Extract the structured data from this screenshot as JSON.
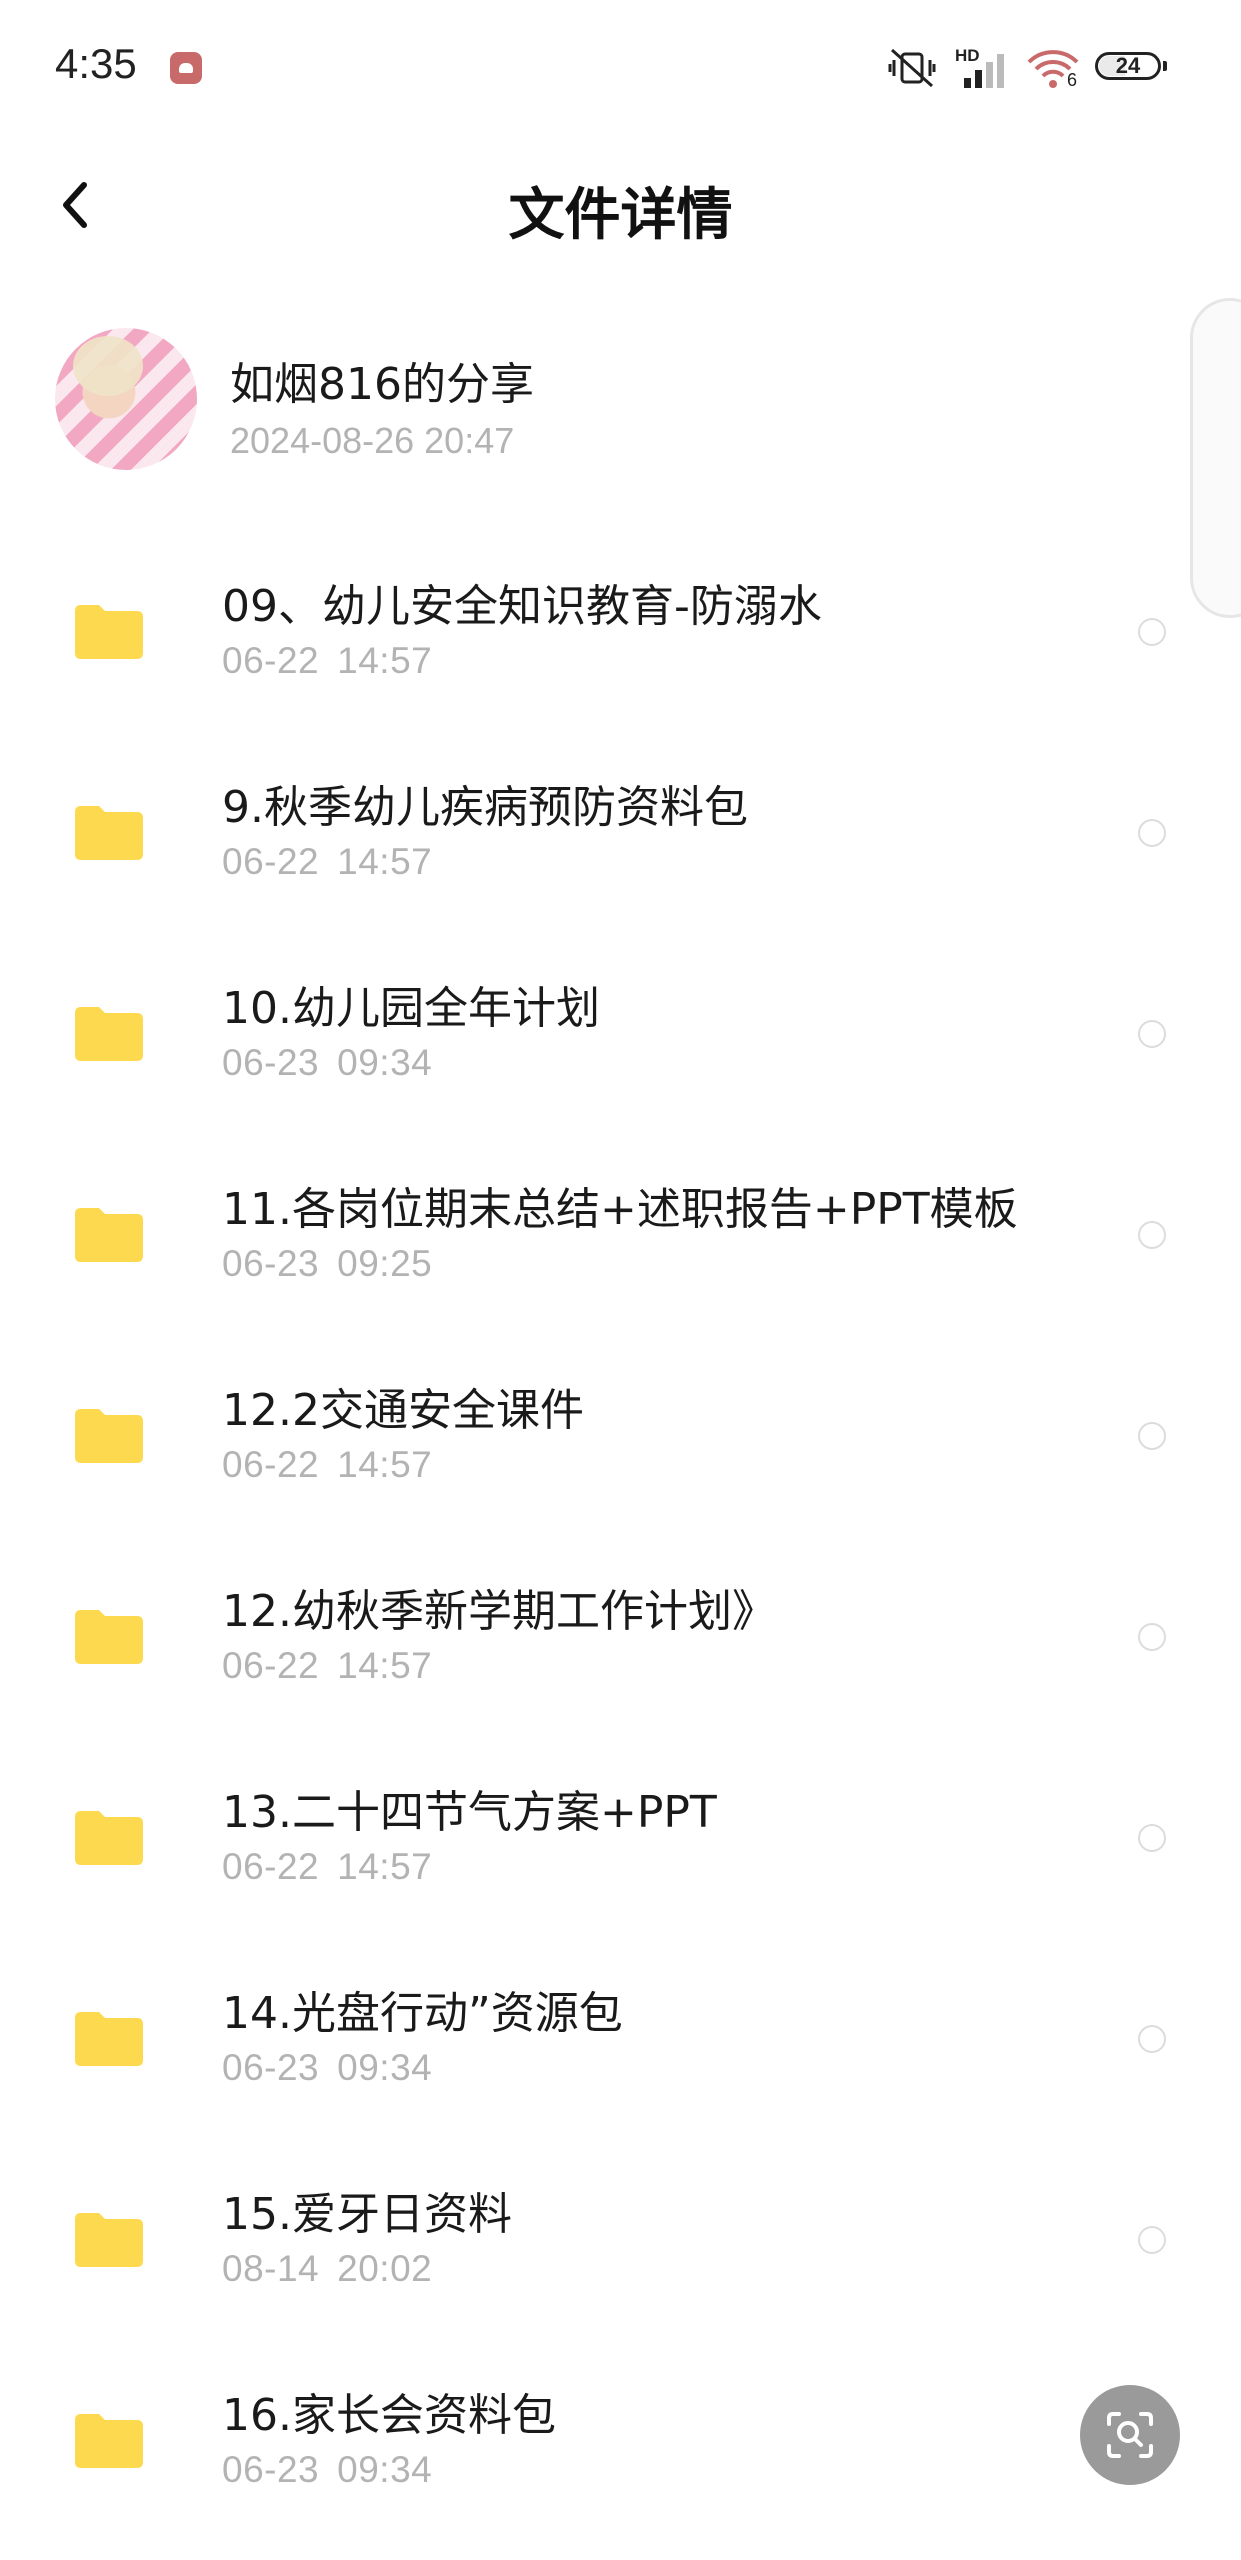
{
  "status_bar": {
    "time": "4:35",
    "network_label": "HD",
    "wifi_badge": "6",
    "battery": "24"
  },
  "header": {
    "title": "文件详情"
  },
  "sharer": {
    "name": "如烟816的分享",
    "datetime": "2024-08-26  20:47"
  },
  "files": [
    {
      "name": "09、幼儿安全知识教育-防溺水",
      "date": "06-22",
      "time": "14:57"
    },
    {
      "name": "9.秋季幼儿疾病预防资料包",
      "date": "06-22",
      "time": "14:57"
    },
    {
      "name": "10.幼儿园全年计划",
      "date": "06-23",
      "time": "09:34"
    },
    {
      "name": "11.各岗位期末总结+述职报告+PPT模板",
      "date": "06-23",
      "time": "09:25"
    },
    {
      "name": "12.2交通安全课件",
      "date": "06-22",
      "time": "14:57"
    },
    {
      "name": "12.幼秋季新学期工作计划》",
      "date": "06-22",
      "time": "14:57"
    },
    {
      "name": "13.二十四节气方案+PPT",
      "date": "06-22",
      "time": "14:57"
    },
    {
      "name": "14.光盘行动”资源包",
      "date": "06-23",
      "time": "09:34"
    },
    {
      "name": "15.爱牙日资料",
      "date": "08-14",
      "time": "20:02"
    },
    {
      "name": "16.家长会资料包",
      "date": "06-23",
      "time": "09:34"
    }
  ],
  "colors": {
    "folder": "#fdd94f",
    "secondary_text": "#b3b3b3",
    "fab": "#9a9a9a"
  },
  "icons": {
    "back": "chevron-left-icon",
    "folder": "folder-icon",
    "fab": "scan-search-icon"
  }
}
